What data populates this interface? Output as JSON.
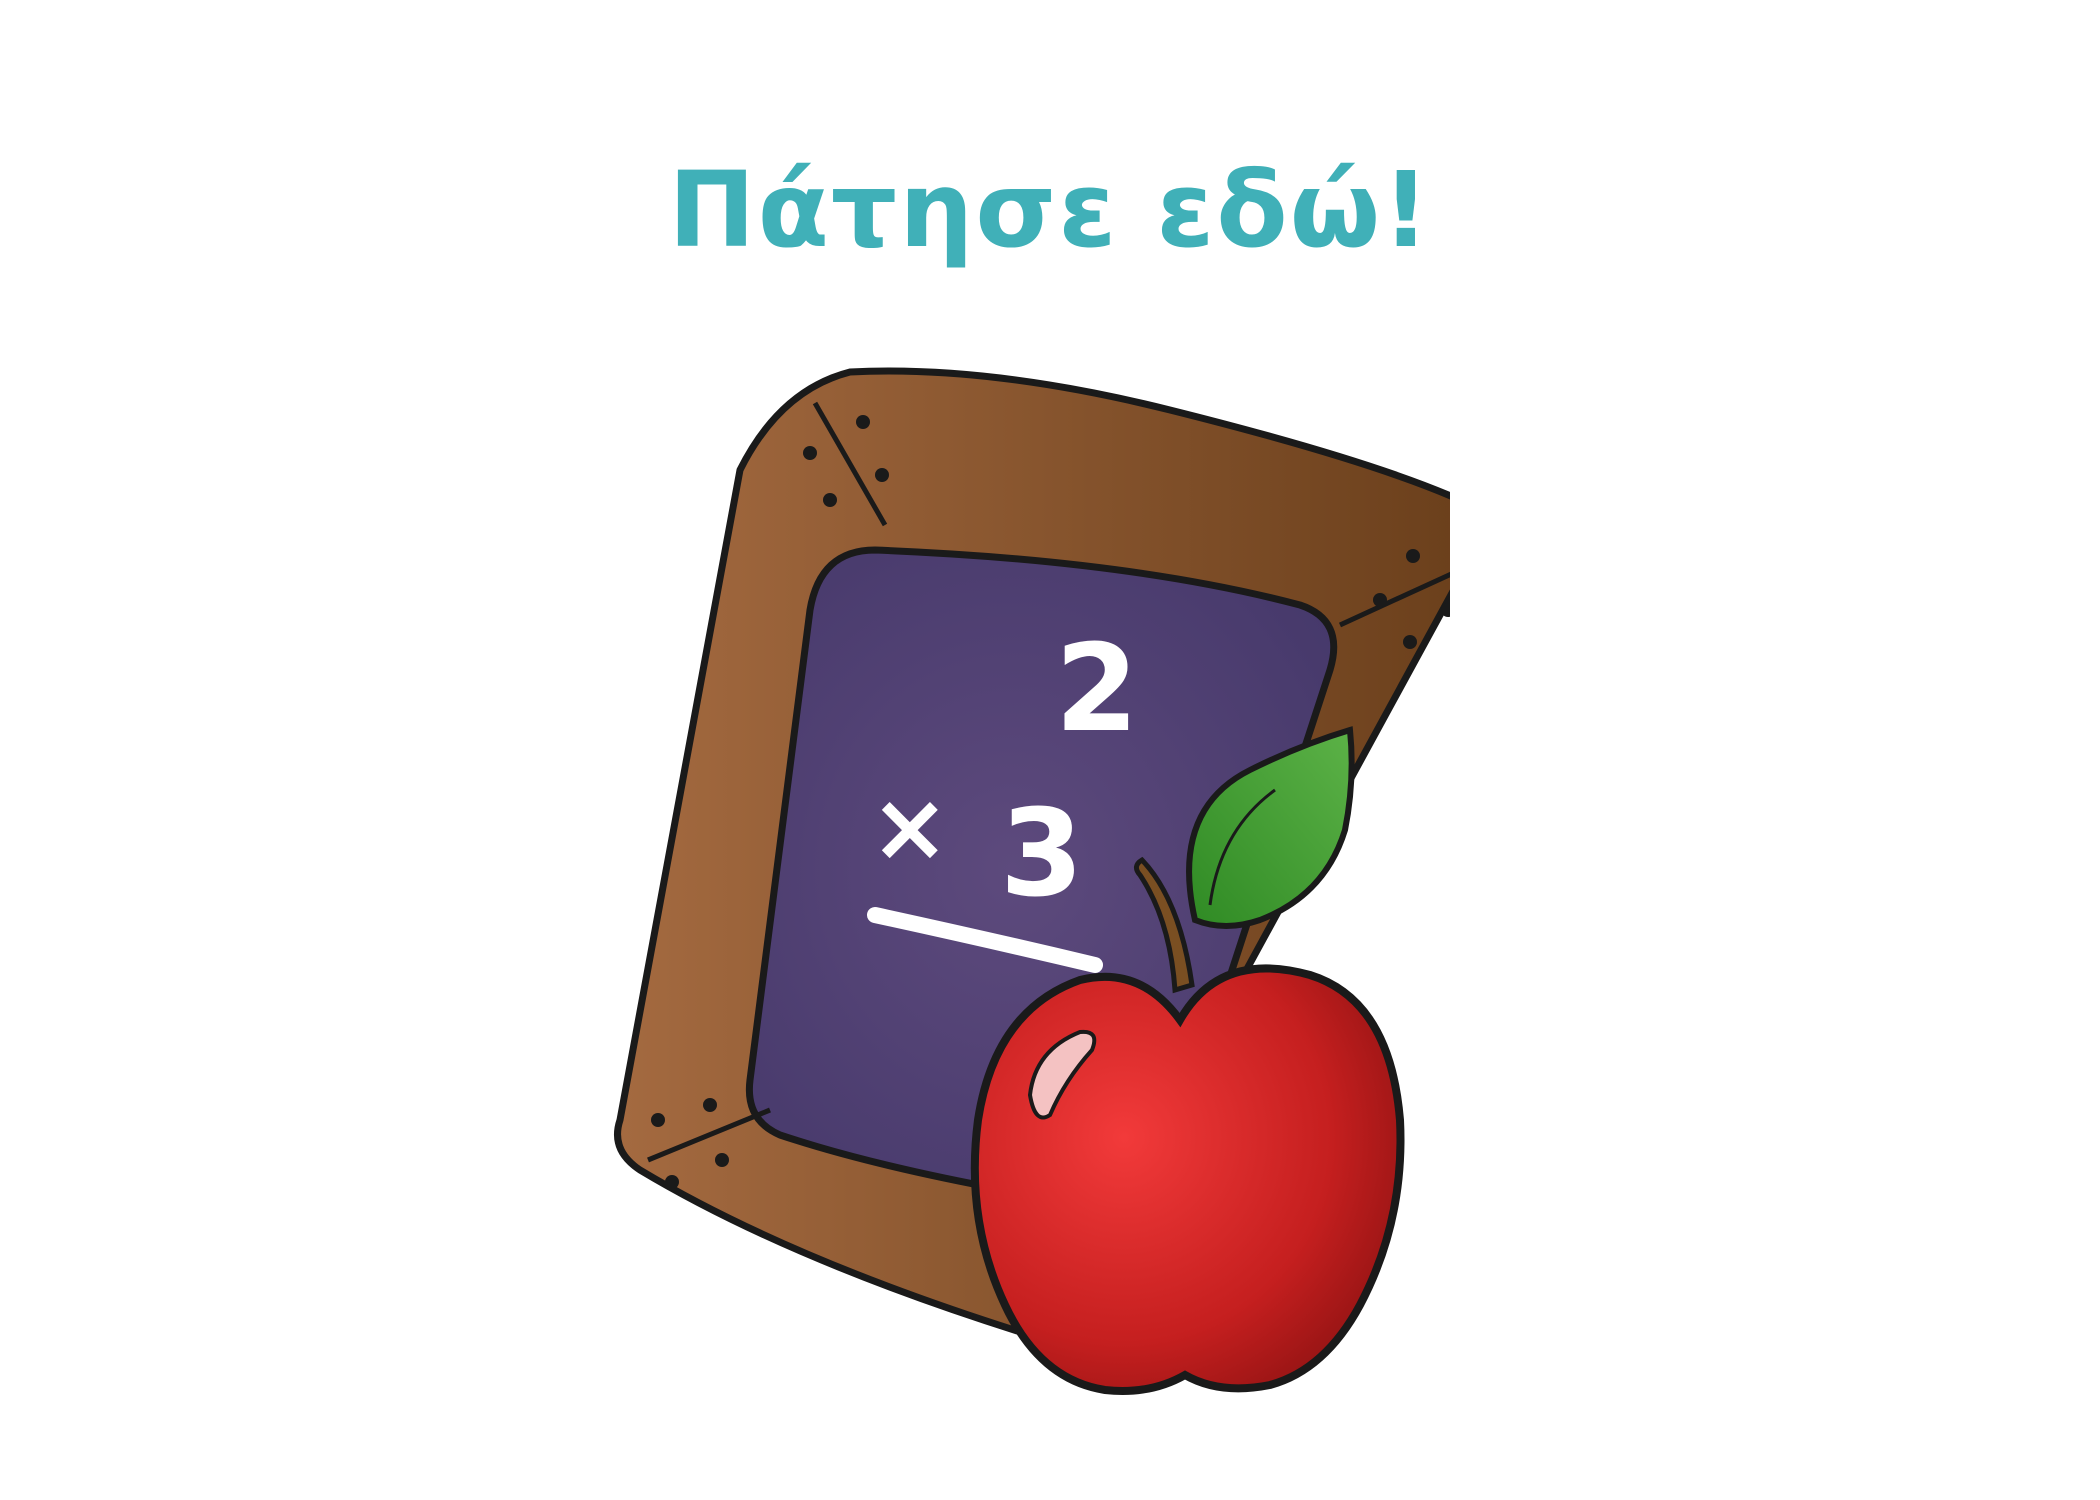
{
  "prompt": {
    "label": "Πάτησε εδώ!",
    "color": "#40b0b8"
  },
  "illustration": {
    "name": "chalkboard-with-apple",
    "chalk": {
      "top_number": "2",
      "operator": "×",
      "bottom_number": "3"
    },
    "colors": {
      "frame": "#8b5a2b",
      "board": "#4e3e72",
      "chalk": "#ffffff",
      "apple": "#d42b2b",
      "leaf": "#3e9a2e",
      "stem": "#7a4f22"
    }
  }
}
